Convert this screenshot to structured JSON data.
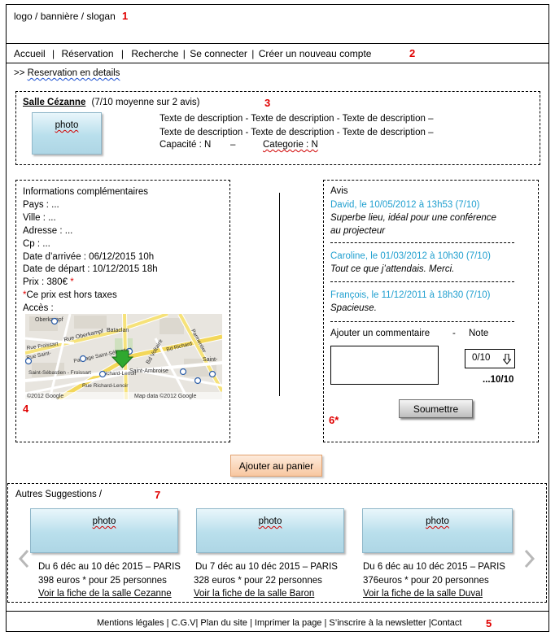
{
  "header": {
    "banner_text": "logo / bannière / slogan",
    "marker": "1"
  },
  "nav": {
    "items": [
      "Accueil",
      "Réservation",
      "Recherche",
      "Se connecter",
      "Créer un nouveau compte"
    ],
    "separators": [
      "|",
      "|",
      "|",
      "|"
    ],
    "marker": "2"
  },
  "breadcrumb": {
    "prefix": ">>",
    "label": "Reservation en details"
  },
  "room": {
    "name": "Salle Cézanne",
    "rating": "(7/10 moyenne sur 2 avis)",
    "marker": "3",
    "photo_label": "photo",
    "description_line1": "Texte de description - Texte de description - Texte de description –",
    "description_line2": "Texte de description - Texte de description - Texte de description –",
    "capacity_label": "Capacité : N",
    "dash": "–",
    "category_label": "Categorie : N"
  },
  "info": {
    "title": "Informations complémentaires",
    "pays": "Pays : ...",
    "ville": "Ville : ...",
    "adresse": "Adresse : ...",
    "cp": "Cp : ...",
    "arrival": "Date d’arrivée : 06/12/2015  10h",
    "departure": "Date de  départ : 10/12/2015 18h",
    "price": "Prix : 380€",
    "asterisk": "*",
    "tax_note": "Ce prix est hors taxes",
    "access": "Accès :",
    "marker": "4",
    "map": {
      "streets": [
        "Oberkampf",
        "Rue Oberkampf",
        "Bataclan",
        "Bd Voltaire",
        "Passage Saint-Sébastien",
        "Saint-Sébastien - Froissart",
        "Rue Richard-Lenoir",
        "Richard-Lenoir",
        "Saint-Ambroise",
        "Saint-",
        "Rue Saint-",
        "Rue Froissart",
        "Bd Richard",
        "Parmentier"
      ],
      "copyright": "©2012 Google",
      "attribution": "Map data ©2012 Google"
    }
  },
  "reviews": {
    "title": "Avis",
    "items": [
      {
        "author": "David, le 10/05/2012 à 13h53  (7/10)",
        "line1": "Superbe lieu, idéal pour une conférence",
        "line2": "au projecteur"
      },
      {
        "author": "Caroline, le 01/03/2012 à 10h30  (7/10)",
        "line1": "Tout ce que j’attendais. Merci.",
        "line2": ""
      },
      {
        "author": "François, le 11/12/2011 à 18h30  (7/10)",
        "line1": "Spacieuse.",
        "line2": ""
      }
    ],
    "add_comment_label": "Ajouter un commentaire",
    "dash": "-",
    "note_label": "Note",
    "note_value": "0/10",
    "note_total": "...10/10",
    "submit_label": "Soumettre",
    "marker": "6*"
  },
  "cart": {
    "add_label": "Ajouter au panier"
  },
  "suggestions": {
    "title": "Autres Suggestions /",
    "marker": "7",
    "items": [
      {
        "photo_label": "photo",
        "dates": "Du 6 déc au 10 déc 2015 – PARIS",
        "price": "398 euros * pour 25 personnes",
        "link": "Voir la fiche de la salle Cezanne"
      },
      {
        "photo_label": "photo",
        "dates": "Du 7 déc au 10 déc 2015 – PARIS",
        "price": "328 euros * pour 22 personnes",
        "link": "Voir la fiche de la salle Baron"
      },
      {
        "photo_label": "photo",
        "dates": "Du 6 déc au 10 déc 2015 – PARIS",
        "price": "376euros * pour 20 personnes",
        "link": "Voir la fiche de la salle Duval"
      }
    ]
  },
  "footer": {
    "links": [
      "Mentions légales",
      "C.G.V",
      "Plan du site",
      "Imprimer la page",
      "S’inscrire à la newsletter",
      "Contact"
    ],
    "marker": "5"
  }
}
